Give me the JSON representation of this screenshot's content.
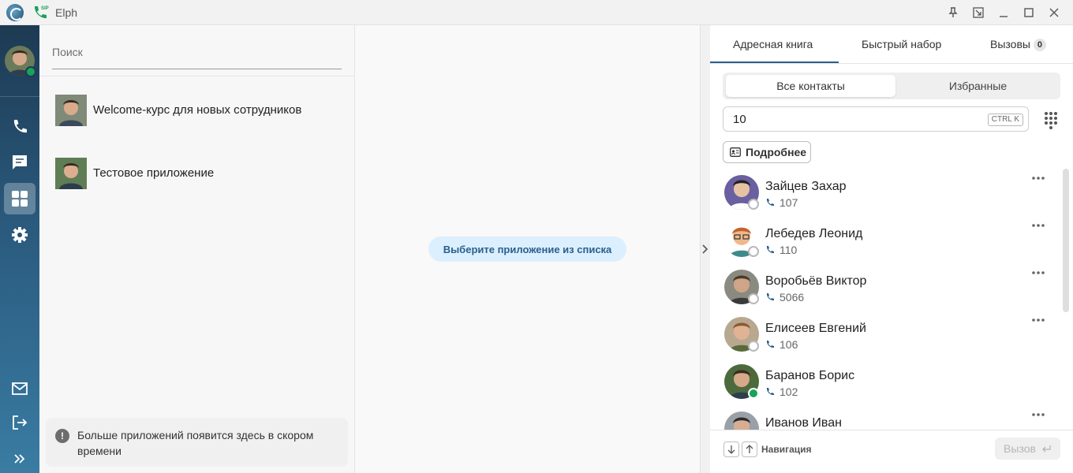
{
  "window": {
    "title": "Elph"
  },
  "apps": {
    "search_placeholder": "Поиск",
    "items": [
      {
        "name": "Welcome-курс для новых сотрудников"
      },
      {
        "name": "Тестовое приложение"
      }
    ],
    "notice": "Больше приложений появится здесь в скором времени"
  },
  "center": {
    "empty_label": "Выберите приложение из списка"
  },
  "right": {
    "tabs": [
      {
        "label": "Адресная книга",
        "active": true
      },
      {
        "label": "Быстрый набор"
      },
      {
        "label": "Вызовы",
        "badge": "0"
      }
    ],
    "segments": {
      "all": "Все контакты",
      "favorites": "Избранные"
    },
    "search": {
      "value": "10",
      "shortcut": "CTRL K"
    },
    "more_button": "Подробнее",
    "contacts": [
      {
        "name": "Зайцев Захар",
        "ext": "107",
        "status": "offline"
      },
      {
        "name": "Лебедев Леонид",
        "ext": "110",
        "status": "offline"
      },
      {
        "name": "Воробьёв Виктор",
        "ext": "5066",
        "status": "offline"
      },
      {
        "name": "Елисеев Евгений",
        "ext": "106",
        "status": "offline"
      },
      {
        "name": "Баранов Борис",
        "ext": "102",
        "status": "online"
      },
      {
        "name": "Иванов Иван",
        "ext": "",
        "status": "offline"
      }
    ],
    "footer": {
      "nav_label": "Навигация",
      "call_label": "Вызов"
    }
  },
  "colors": {
    "accent": "#2a5f8d",
    "online": "#19a25a",
    "rail": "#1d3a52",
    "pill_bg": "#dcefff"
  }
}
